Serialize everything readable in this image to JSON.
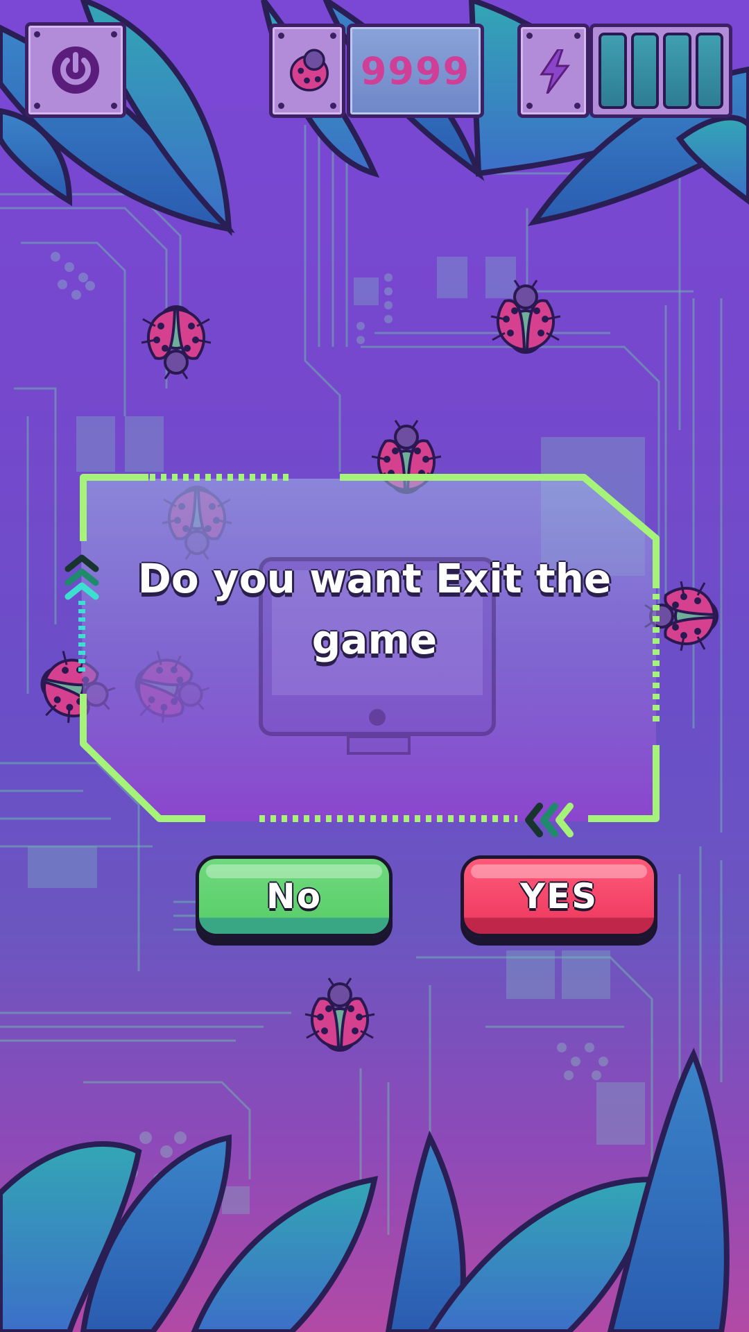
{
  "hud": {
    "score": "9999",
    "energy_bars_filled": 4,
    "energy_bars_total": 4
  },
  "dialog": {
    "message": "Do you want Exit the game",
    "no_label": "No",
    "yes_label": "YES"
  },
  "icons": {
    "power": "power-icon",
    "bug": "ladybug-icon",
    "energy": "lightning-icon"
  },
  "colors": {
    "no_button": "#5ccf6c",
    "yes_button": "#f03e63",
    "score_text": "#cf3f98",
    "frame": "#a6f37a"
  }
}
